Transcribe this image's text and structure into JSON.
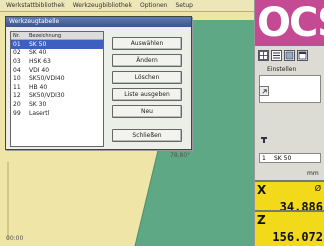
{
  "menubar": {
    "items": [
      "Werkstattbibliothek",
      "Werkzeugbibliothek",
      "Optionen",
      "Setup"
    ]
  },
  "workspace": {
    "angle_label": "78.80°",
    "corner_label": "00:00"
  },
  "dialog": {
    "title": "Werkzeugtabelle",
    "columns": [
      "Nr.",
      "Bezeichnung"
    ],
    "rows": [
      {
        "nr": "01",
        "name": "SK 50",
        "selected": true
      },
      {
        "nr": "02",
        "name": "SK 40",
        "selected": false
      },
      {
        "nr": "03",
        "name": "HSK 63",
        "selected": false
      },
      {
        "nr": "04",
        "name": "VDI 40",
        "selected": false
      },
      {
        "nr": "10",
        "name": "SK50/VDI40",
        "selected": false
      },
      {
        "nr": "11",
        "name": "HB 40",
        "selected": false
      },
      {
        "nr": "12",
        "name": "SK50/VDI30",
        "selected": false
      },
      {
        "nr": "20",
        "name": "SK 30",
        "selected": false
      },
      {
        "nr": "99",
        "name": "Lasertl",
        "selected": false
      }
    ],
    "buttons": {
      "select": "Auswählen",
      "edit": "Ändern",
      "delete": "Löschen",
      "print": "Liste ausgeben",
      "new": "Neu",
      "close": "Schließen"
    }
  },
  "panel": {
    "logo": "OCS",
    "settings_label": "Einstellen",
    "field_value": "SK 50",
    "field_index": "1",
    "unit_label": "mm",
    "x": {
      "axis": "X",
      "symbol": "Ø",
      "value": "34.886"
    },
    "z": {
      "axis": "Z",
      "value": "156.072"
    }
  },
  "colors": {
    "stock_green": "#5fa886",
    "highlight_blue": "#3d5fc0",
    "readout_yellow": "#f2d91a",
    "logo_magenta": "#c34a93"
  }
}
